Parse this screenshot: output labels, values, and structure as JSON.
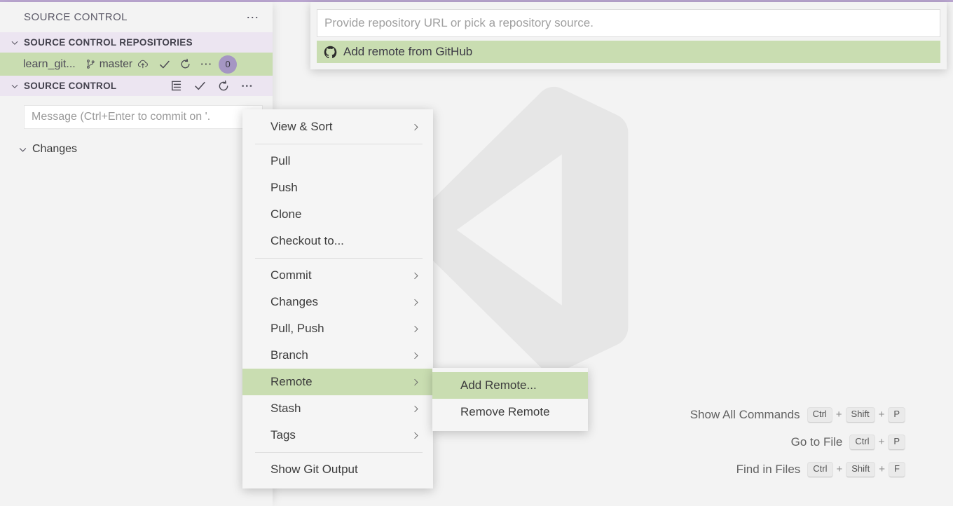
{
  "theme": {
    "accent_top_border": "#b9a5cf",
    "selection_green": "#c9ddb1",
    "section_header_lavender": "#ece5f1",
    "badge_purple": "#a596c3",
    "app_background": "#f3f3f3"
  },
  "sidebar": {
    "title": "SOURCE CONTROL",
    "title_more_icon": "ellipsis-icon",
    "repositories_section": {
      "label": "SOURCE CONTROL REPOSITORIES",
      "chevron": "chevron-down-icon",
      "repository": {
        "name": "learn_git...",
        "branch_icon": "git-branch-icon",
        "branch": "master",
        "sync_icon": "cloud-upload-icon",
        "actions": [
          "check-icon",
          "refresh-icon",
          "ellipsis-icon"
        ],
        "badge": "0"
      }
    },
    "source_control_section": {
      "label": "SOURCE CONTROL",
      "chevron": "chevron-down-icon",
      "actions": [
        "view-as-tree-icon",
        "check-icon",
        "refresh-icon",
        "ellipsis-icon"
      ]
    },
    "commit_input": {
      "placeholder": "Message (Ctrl+Enter to commit on '."
    },
    "changes_group": {
      "chevron": "chevron-down-icon",
      "label": "Changes",
      "badge": ""
    }
  },
  "quick_input": {
    "placeholder": "Provide repository URL or pick a repository source.",
    "value": "",
    "items": [
      {
        "icon": "github-icon",
        "label": "Add remote from GitHub",
        "selected": true
      }
    ]
  },
  "context_menu": {
    "items": [
      {
        "label": "View & Sort",
        "submenu": true
      },
      {
        "separator": true
      },
      {
        "label": "Pull",
        "submenu": false
      },
      {
        "label": "Push",
        "submenu": false
      },
      {
        "label": "Clone",
        "submenu": false
      },
      {
        "label": "Checkout to...",
        "submenu": false
      },
      {
        "separator": true
      },
      {
        "label": "Commit",
        "submenu": true
      },
      {
        "label": "Changes",
        "submenu": true
      },
      {
        "label": "Pull, Push",
        "submenu": true
      },
      {
        "label": "Branch",
        "submenu": true
      },
      {
        "label": "Remote",
        "submenu": true,
        "selected": true
      },
      {
        "label": "Stash",
        "submenu": true
      },
      {
        "label": "Tags",
        "submenu": true
      },
      {
        "separator": true
      },
      {
        "label": "Show Git Output",
        "submenu": false
      }
    ]
  },
  "context_submenu": {
    "items": [
      {
        "label": "Add Remote...",
        "selected": true
      },
      {
        "label": "Remove Remote",
        "selected": false
      }
    ]
  },
  "editor_watermark": {
    "logo": "vscode-logo-icon",
    "shortcuts": [
      {
        "label": "Show All Commands",
        "keys": [
          "Ctrl",
          "Shift",
          "P"
        ]
      },
      {
        "label": "Go to File",
        "keys": [
          "Ctrl",
          "P"
        ]
      },
      {
        "label": "Find in Files",
        "keys": [
          "Ctrl",
          "Shift",
          "F"
        ]
      }
    ]
  }
}
